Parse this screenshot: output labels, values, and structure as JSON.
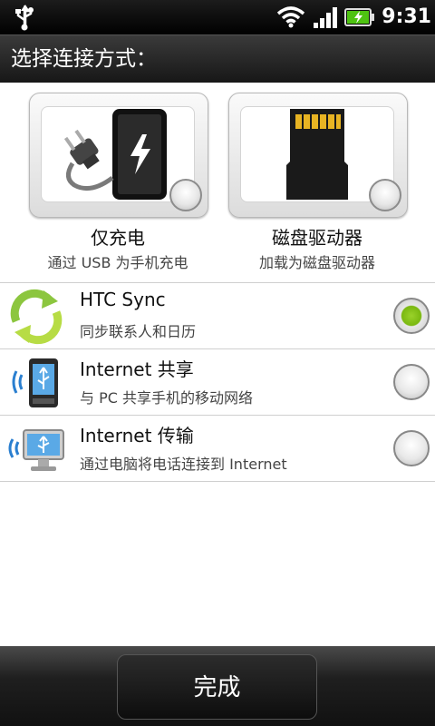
{
  "status_bar": {
    "time": "9:31",
    "icons": [
      "usb-icon",
      "wifi-icon",
      "signal-icon",
      "battery-charging-icon"
    ]
  },
  "header": {
    "title": "选择连接方式："
  },
  "cards": [
    {
      "title": "仅充电",
      "subtitle": "通过 USB 为手机充电",
      "icon": "charge-plug-phone-icon",
      "selected": false
    },
    {
      "title": "磁盘驱动器",
      "subtitle": "加载为磁盘驱动器",
      "icon": "sd-card-icon",
      "selected": false
    }
  ],
  "options": [
    {
      "title": "HTC Sync",
      "subtitle": "同步联系人和日历",
      "icon": "sync-arrows-icon",
      "selected": true
    },
    {
      "title": "Internet 共享",
      "subtitle": "与 PC 共享手机的移动网络",
      "icon": "phone-usb-wireless-icon",
      "selected": false
    },
    {
      "title": "Internet 传输",
      "subtitle": "通过电脑将电话连接到 Internet",
      "icon": "monitor-usb-wireless-icon",
      "selected": false
    }
  ],
  "footer": {
    "done_label": "完成"
  },
  "colors": {
    "selected_radio": "#7ab810",
    "header_bg": "#2a2a2a"
  }
}
